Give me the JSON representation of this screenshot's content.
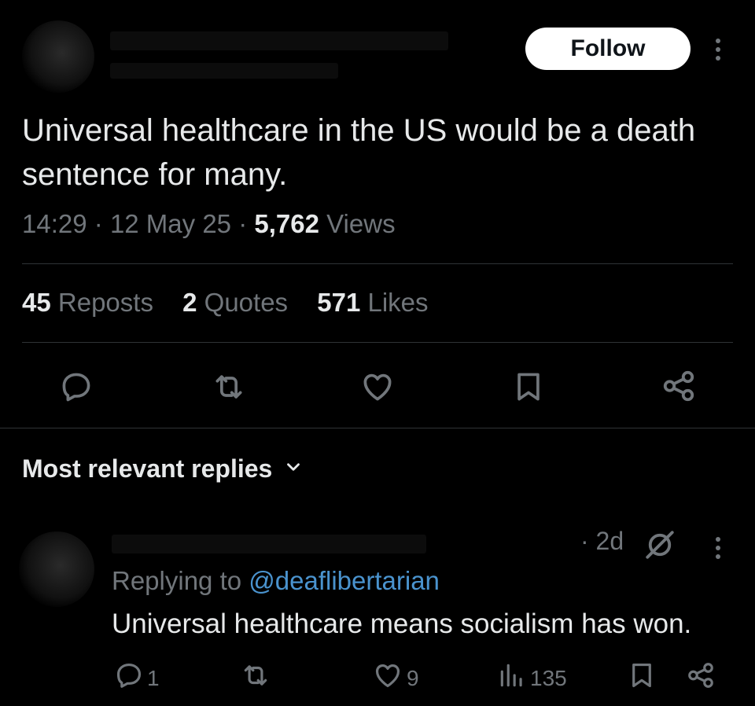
{
  "header": {
    "follow_label": "Follow"
  },
  "post": {
    "text": "Universal healthcare in the US would be a death sentence for many.",
    "time": "14:29",
    "date": "12 May 25",
    "views_count": "5,762",
    "views_label": "Views",
    "sep": "·"
  },
  "stats": {
    "reposts_count": "45",
    "reposts_label": "Reposts",
    "quotes_count": "2",
    "quotes_label": "Quotes",
    "likes_count": "571",
    "likes_label": "Likes"
  },
  "actions": [
    "reply-icon",
    "repost-icon",
    "like-icon",
    "bookmark-icon",
    "share-icon"
  ],
  "replies": {
    "heading": "Most relevant replies",
    "items": [
      {
        "age": "· 2d",
        "replying_prefix": "Replying to",
        "replying_handle": "@deaflibertarian",
        "text": "Universal healthcare means socialism has won.",
        "reply_count": "1",
        "like_count": "9",
        "view_count": "135"
      }
    ]
  },
  "colors": {
    "background": "#000000",
    "text": "#e7e9ea",
    "muted": "#71767b",
    "link": "#4a93ce",
    "divider": "#2f3336"
  }
}
